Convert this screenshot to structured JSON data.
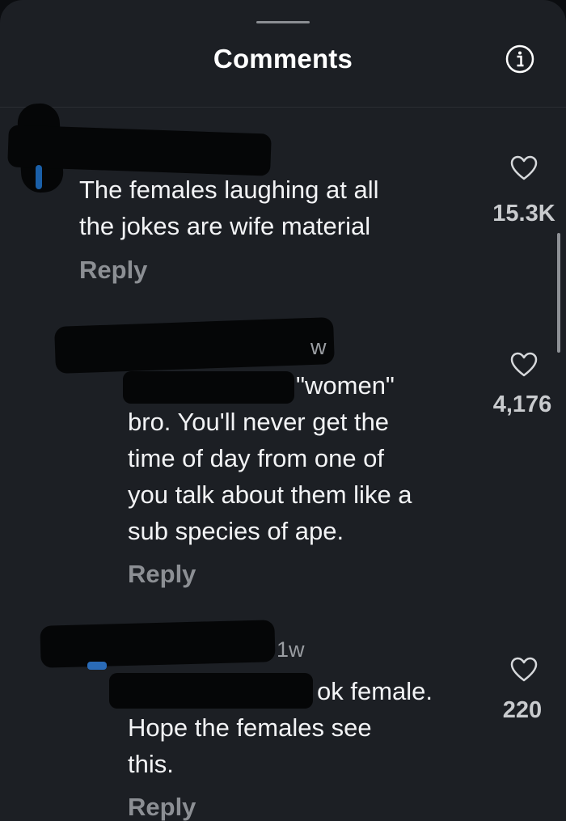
{
  "header": {
    "title": "Comments"
  },
  "icons": {
    "info": "info-icon",
    "heart": "heart-outline-icon"
  },
  "colors": {
    "background": "#1c1f24",
    "text": "#f2f3f5",
    "muted": "#8c8f94"
  },
  "comments": [
    {
      "meta": "",
      "text": "The females laughing at all\nthe jokes are wife material",
      "reply_label": "Reply",
      "likes": "15.3K"
    },
    {
      "meta": "w",
      "text": "\"women\"",
      "text_continued": "bro. You'll never get the\ntime of day from one of\nyou talk about them like a\nsub species of ape.",
      "reply_label": "Reply",
      "likes": "4,176"
    },
    {
      "meta": "1w",
      "text": "ok female.",
      "text_continued": "Hope the females see\nthis.",
      "reply_label": "Reply",
      "likes": "220"
    }
  ]
}
